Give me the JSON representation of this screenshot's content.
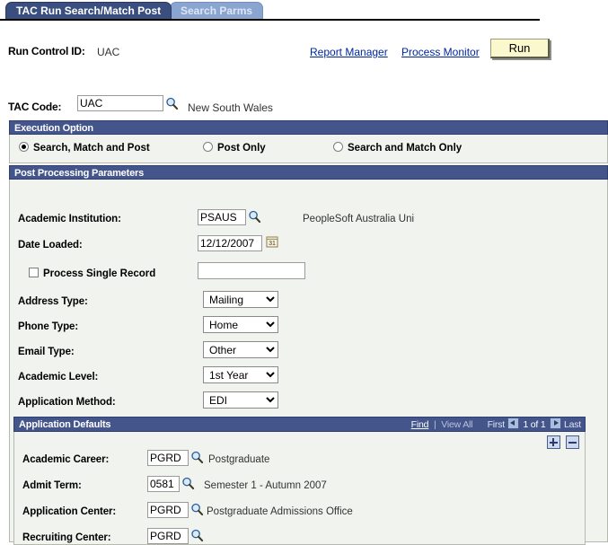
{
  "tabs": [
    {
      "label": "TAC Run Search/Match Post",
      "active": true
    },
    {
      "label": "Search Parms",
      "active": false
    }
  ],
  "header": {
    "run_control_label": "Run Control ID:",
    "run_control_value": "UAC",
    "report_manager_link": "Report Manager",
    "process_monitor_link": "Process Monitor",
    "run_button": "Run"
  },
  "tac": {
    "label": "TAC Code:",
    "value": "UAC",
    "lookup_icon": "magnifier-icon",
    "description": "New South Wales"
  },
  "execution_option": {
    "title": "Execution Option",
    "options": [
      {
        "label": "Search, Match and Post",
        "selected": true
      },
      {
        "label": "Post Only",
        "selected": false
      },
      {
        "label": "Search and Match Only",
        "selected": false
      }
    ]
  },
  "post_processing": {
    "title": "Post Processing Parameters",
    "academic_institution": {
      "label": "Academic Institution:",
      "value": "PSAUS",
      "lookup_icon": "magnifier-icon",
      "description": "PeopleSoft Australia Uni"
    },
    "date_loaded": {
      "label": "Date Loaded:",
      "value": "12/12/2007",
      "calendar_icon": "calendar-icon",
      "calendar_day": "31"
    },
    "process_single_record": {
      "label": "Process Single Record",
      "checked": false,
      "value": ""
    },
    "dropdowns": [
      {
        "label": "Address Type:",
        "value": "Mailing"
      },
      {
        "label": "Phone Type:",
        "value": "Home"
      },
      {
        "label": "Email Type:",
        "value": "Other"
      },
      {
        "label": "Academic Level:",
        "value": "1st Year"
      },
      {
        "label": "Application Method:",
        "value": "EDI"
      }
    ]
  },
  "application_defaults": {
    "title": "Application Defaults",
    "nav": {
      "find": "Find",
      "separator": "|",
      "view_all": "View All",
      "first": "First",
      "prev_icon": "prev-arrow-icon",
      "counter": "1 of 1",
      "next_icon": "next-arrow-icon",
      "last": "Last",
      "add_row_icon": "plus-icon",
      "delete_row_icon": "minus-icon"
    },
    "rows": [
      {
        "label": "Academic Career:",
        "value": "PGRD",
        "description": "Postgraduate"
      },
      {
        "label": "Admit Term:",
        "value": "0581",
        "description": "Semester 1 - Autumn 2007"
      },
      {
        "label": "Application Center:",
        "value": "PGRD",
        "description": "Postgraduate Admissions Office"
      },
      {
        "label": "Recruiting Center:",
        "value": "PGRD",
        "description": ""
      }
    ]
  },
  "colors": {
    "tab_active_bg": "#3a4f7f",
    "tab_inactive_bg": "#8aa5cf",
    "group_header_bg": "#44558c",
    "group_body_bg": "#f1f3ee",
    "link": "#00269e",
    "run_button_bg": "#fbf8cd"
  }
}
